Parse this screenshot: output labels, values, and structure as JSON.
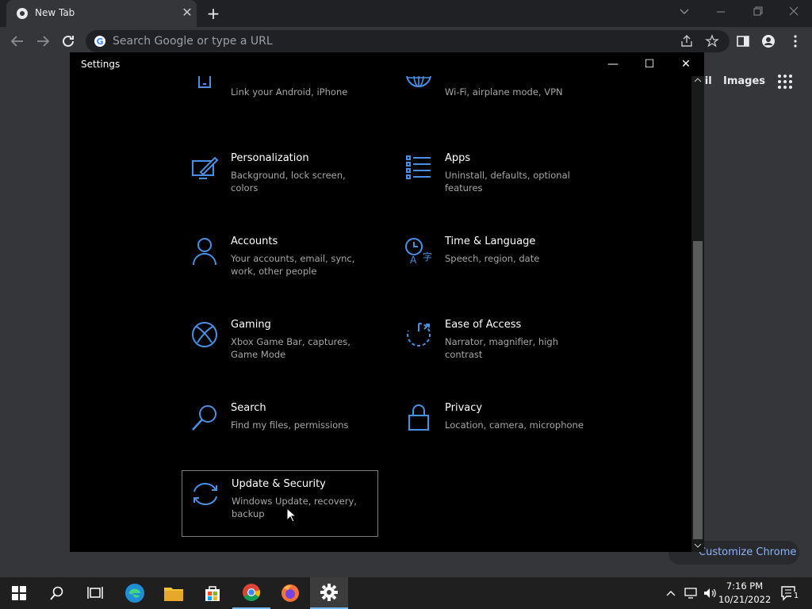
{
  "browser": {
    "tab_title": "New Tab",
    "omnibox_placeholder": "Search Google or type a URL",
    "gmail_label": "ail",
    "images_label": "Images",
    "customize_label": "Customize Chrome"
  },
  "settings": {
    "window_title": "Settings",
    "tiles": [
      {
        "title": "",
        "desc": "Link your Android, iPhone",
        "icon": "phone-icon"
      },
      {
        "title": "",
        "desc": "Wi-Fi, airplane mode, VPN",
        "icon": "globe-icon"
      },
      {
        "title": "Personalization",
        "desc": "Background, lock screen, colors",
        "icon": "paint-icon"
      },
      {
        "title": "Apps",
        "desc": "Uninstall, defaults, optional features",
        "icon": "apps-list-icon"
      },
      {
        "title": "Accounts",
        "desc": "Your accounts, email, sync, work, other people",
        "icon": "person-icon"
      },
      {
        "title": "Time & Language",
        "desc": "Speech, region, date",
        "icon": "time-language-icon"
      },
      {
        "title": "Gaming",
        "desc": "Xbox Game Bar, captures, Game Mode",
        "icon": "xbox-icon"
      },
      {
        "title": "Ease of Access",
        "desc": "Narrator, magnifier, high contrast",
        "icon": "ease-of-access-icon"
      },
      {
        "title": "Search",
        "desc": "Find my files, permissions",
        "icon": "search-icon"
      },
      {
        "title": "Privacy",
        "desc": "Location, camera, microphone",
        "icon": "lock-icon"
      },
      {
        "title": "Update & Security",
        "desc": "Windows Update, recovery, backup",
        "icon": "sync-icon"
      }
    ]
  },
  "taskbar": {
    "time": "7:16 PM",
    "date": "10/21/2022",
    "notification_count": "1",
    "apps": [
      "start-icon",
      "search-icon",
      "task-view-icon",
      "edge-icon",
      "file-explorer-icon",
      "store-icon",
      "chrome-icon",
      "firefox-icon",
      "settings-gear-icon"
    ]
  },
  "colors": {
    "accent": "#4a90e2",
    "window_bg": "#000000",
    "taskbar_bg": "#1f1f1f"
  }
}
